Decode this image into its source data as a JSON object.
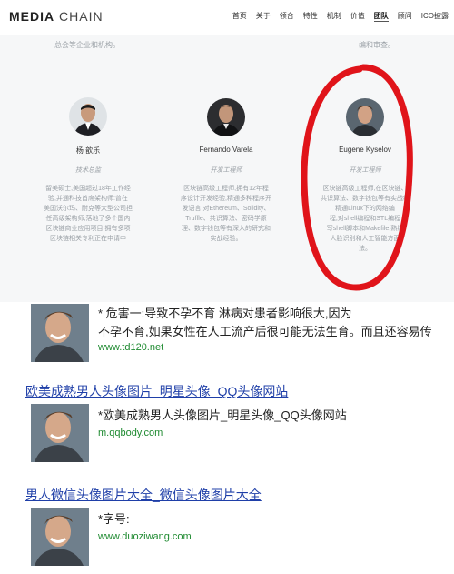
{
  "site": {
    "logo_bold": "MEDIA",
    "logo_light": "CHAIN",
    "nav": [
      "首页",
      "关于",
      "领合",
      "特性",
      "机制",
      "价值",
      "团队",
      "顾问",
      "ICO披露"
    ],
    "faded_top_left": "总会等企业和机构。",
    "faded_top_right": "编和审查。",
    "members": [
      {
        "name": "杨 歆乐",
        "role": "技术总监",
        "desc": [
          "留美硕士,美国超过18年工作经",
          "验,并通科技首席架构师:曾在",
          "美国沃尔玛、耐克等大型公司担",
          "任高级架构师;落地了多个国内",
          "区块链商业应用项目,拥有多项",
          "区块链相关专利正在申请中"
        ]
      },
      {
        "name": "Fernando Varela",
        "role": "开发工程师",
        "desc": [
          "区块链高级工程师,拥有12年程",
          "序设计开发经验,精通多种程序开",
          "发语言,对Ethereum、Solidity、",
          "Truffle、共识算法、密码学原",
          "理、数字钱包等有深入的研究和",
          "实战经验。"
        ]
      },
      {
        "name": "Eugene Kyselov",
        "role": "开发工程师",
        "desc": [
          "区块链高级工程师,在区块链、",
          "共识算法、数字钱包等有实战经",
          "精通Linux下的网络编",
          "程,对shell编程和STL编程",
          "写shell脚本和Makefile,熟练",
          "人脸识别和人工智能方面",
          "法。"
        ]
      }
    ]
  },
  "results": [
    {
      "title": "",
      "line1": "*        危害一:导致不孕不育        淋病对患者影响很大,因为",
      "line2": "不孕不育,如果女性在人工流产后很可能无法生育。而且还容易传",
      "url": "www.td120.net"
    },
    {
      "title": "欧美成熟男人头像图片_明星头像_QQ头像网站",
      "line1": "*欧美成熟男人头像图片_明星头像_QQ头像网站",
      "line2": "",
      "url": "m.qqbody.com"
    },
    {
      "title": "男人微信头像图片大全_微信头像图片大全",
      "line1": "*字号:",
      "line2": "",
      "url": "www.duoziwang.com"
    }
  ],
  "colors": {
    "link_blue": "#1f3fa8",
    "url_green": "#1e8a30",
    "circle_red": "#e0141a"
  }
}
